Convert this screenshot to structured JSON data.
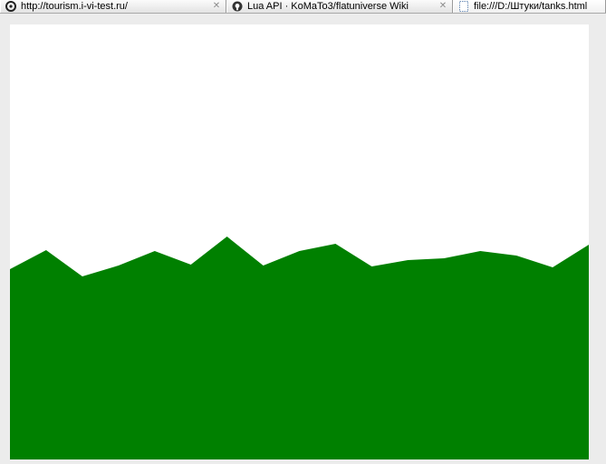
{
  "tabs": [
    {
      "title": "http://tourism.i-vi-test.ru/",
      "icon": "opera-like-site-icon",
      "active": false
    },
    {
      "title": "Lua API · KoMaTo3/flatuniverse Wiki",
      "icon": "github-icon",
      "active": false
    },
    {
      "title": "file:///D:/Штуки/tanks.html",
      "icon": "blank-page-icon",
      "active": true
    }
  ],
  "close_glyph": "✕",
  "game": {
    "sky_color": "#ffffff",
    "ground_color": "#008000",
    "terrain_heights": [
      210,
      231,
      202,
      214,
      230,
      215,
      246,
      214,
      230,
      238,
      213,
      220,
      222,
      230,
      225,
      212,
      237
    ]
  }
}
